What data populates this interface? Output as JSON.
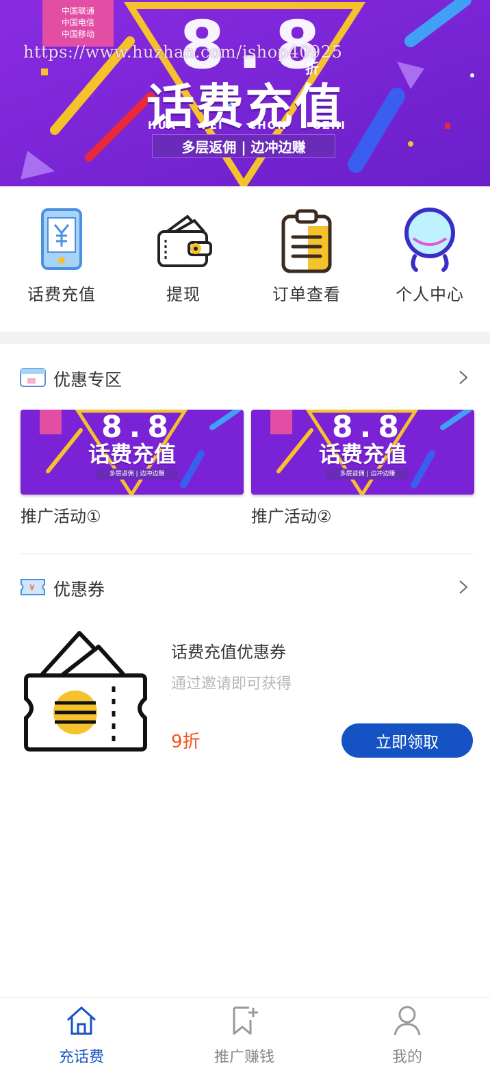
{
  "banner": {
    "watermark": "https://www.huzhan.com/ishop40925",
    "carriers": [
      "中国联通",
      "中国电信",
      "中国移动"
    ],
    "big_number": "8.8",
    "zhe": "折",
    "title": "话费充值",
    "pinyin": [
      "HUA",
      "FEI",
      "CHON",
      "GZHI"
    ],
    "tagline": "多层返佣 | 边冲边赚"
  },
  "quick_menu": [
    {
      "label": "话费充值",
      "icon": "phone-yuan-icon"
    },
    {
      "label": "提现",
      "icon": "wallet-icon"
    },
    {
      "label": "订单查看",
      "icon": "clipboard-icon"
    },
    {
      "label": "个人中心",
      "icon": "user-circle-icon"
    }
  ],
  "promo_section": {
    "title": "优惠专区",
    "items": [
      {
        "caption": "推广活动①"
      },
      {
        "caption": "推广活动②"
      }
    ]
  },
  "coupon_section": {
    "title": "优惠券",
    "coupon": {
      "title": "话费充值优惠券",
      "description": "通过邀请即可获得",
      "discount": "9折",
      "button_label": "立即领取"
    }
  },
  "tabbar": {
    "tabs": [
      {
        "label": "充话费",
        "icon": "home-icon",
        "active": true
      },
      {
        "label": "推广赚钱",
        "icon": "bookmark-plus-icon",
        "active": false
      },
      {
        "label": "我的",
        "icon": "person-icon",
        "active": false
      }
    ]
  },
  "colors": {
    "accent": "#1553c4",
    "discount": "#f5541e",
    "banner_bg": "#7a22d6",
    "carrier_badge": "#e24ea3"
  }
}
